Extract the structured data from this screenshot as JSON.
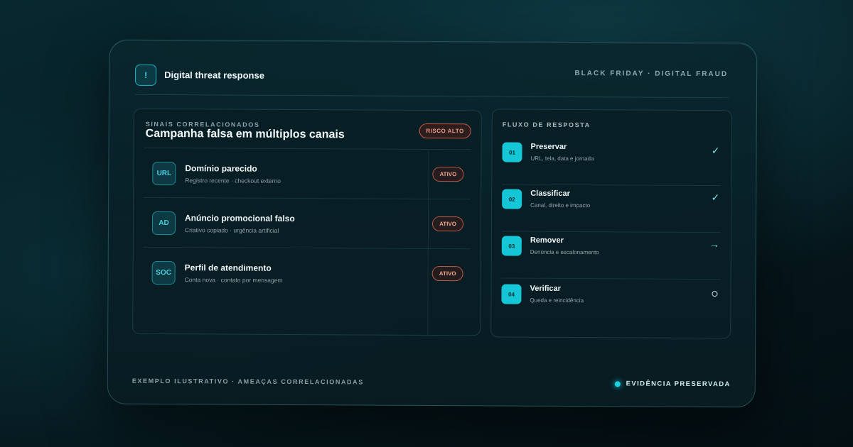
{
  "header": {
    "icon": "alert-icon",
    "icon_glyph": "!",
    "title": "Digital threat response",
    "tag": "BLACK FRIDAY · DIGITAL FRAUD"
  },
  "signals_panel": {
    "eyebrow": "SINAIS CORRELACIONADOS",
    "title": "Campanha falsa em múltiplos canais",
    "risk_badge": "RISCO ALTO",
    "items": [
      {
        "icon_text": "URL",
        "name": "Domínio parecido",
        "description": "Registro recente · checkout externo",
        "status": "ATIVO"
      },
      {
        "icon_text": "AD",
        "name": "Anúncio promocional falso",
        "description": "Criativo copiado · urgência artificial",
        "status": "ATIVO"
      },
      {
        "icon_text": "SOC",
        "name": "Perfil de atendimento",
        "description": "Conta nova · contato por mensagem",
        "status": "ATIVO"
      }
    ]
  },
  "flow_panel": {
    "label": "FLUXO DE RESPOSTA",
    "steps": [
      {
        "number": "01",
        "name": "Preservar",
        "description": "URL, tela, data e jornada",
        "status_icon": "check-icon",
        "status_glyph": "✓"
      },
      {
        "number": "02",
        "name": "Classificar",
        "description": "Canal, direito e impacto",
        "status_icon": "check-icon",
        "status_glyph": "✓"
      },
      {
        "number": "03",
        "name": "Remover",
        "description": "Denúncia e escalonamento",
        "status_icon": "arrow-right-icon",
        "status_glyph": "→"
      },
      {
        "number": "04",
        "name": "Verificar",
        "description": "Queda e reincidência",
        "status_icon": "pending-circle-icon",
        "status_glyph": ""
      }
    ]
  },
  "footer": {
    "left": "EXEMPLO ILUSTRATIVO · AMEAÇAS CORRELACIONADAS",
    "right": "EVIDÊNCIA PRESERVADA"
  },
  "colors": {
    "accent": "#19d3e4",
    "risk": "#f09a84",
    "background": "#061c22"
  }
}
